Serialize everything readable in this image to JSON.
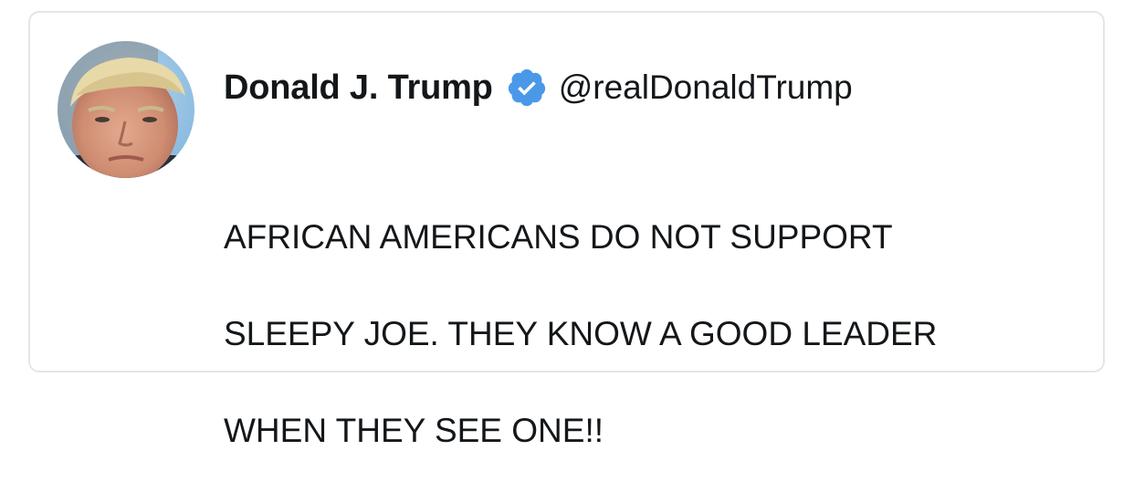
{
  "tweet": {
    "author": {
      "display_name": "Donald J. Trump",
      "handle": "@realDonaldTrump",
      "verified": true,
      "avatar_icon": "profile-photo"
    },
    "text_lines": [
      "AFRICAN AMERICANS DO NOT SUPPORT",
      "SLEEPY JOE. THEY KNOW A GOOD LEADER",
      "WHEN THEY SEE ONE!!"
    ]
  },
  "colors": {
    "verified_badge": "#4a99e9",
    "text": "#14171a",
    "border": "#e3e5e8"
  }
}
